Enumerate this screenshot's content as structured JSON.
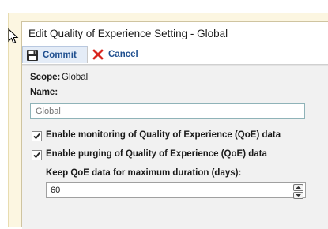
{
  "dialog": {
    "title": "Edit Quality of Experience Setting - Global"
  },
  "toolbar": {
    "commit_label": "Commit",
    "cancel_label": "Cancel"
  },
  "form": {
    "scope_label": "Scope:",
    "scope_value": "Global",
    "name_label": "Name:",
    "name_placeholder": "Global",
    "enable_monitoring_label": "Enable monitoring of Quality of Experience (QoE) data",
    "enable_monitoring_checked": true,
    "enable_purging_label": "Enable purging of Quality of Experience (QoE) data",
    "enable_purging_checked": true,
    "keep_duration_label": "Keep QoE data for maximum duration (days):",
    "keep_duration_value": "60"
  },
  "icons": {
    "commit": "floppy-disk-icon",
    "cancel": "red-x-icon"
  },
  "colors": {
    "accent_link": "#1f4f8f",
    "cancel_red": "#d8261f",
    "dialog_frame": "#fcf6e1",
    "input_border": "#8fb3b8"
  }
}
